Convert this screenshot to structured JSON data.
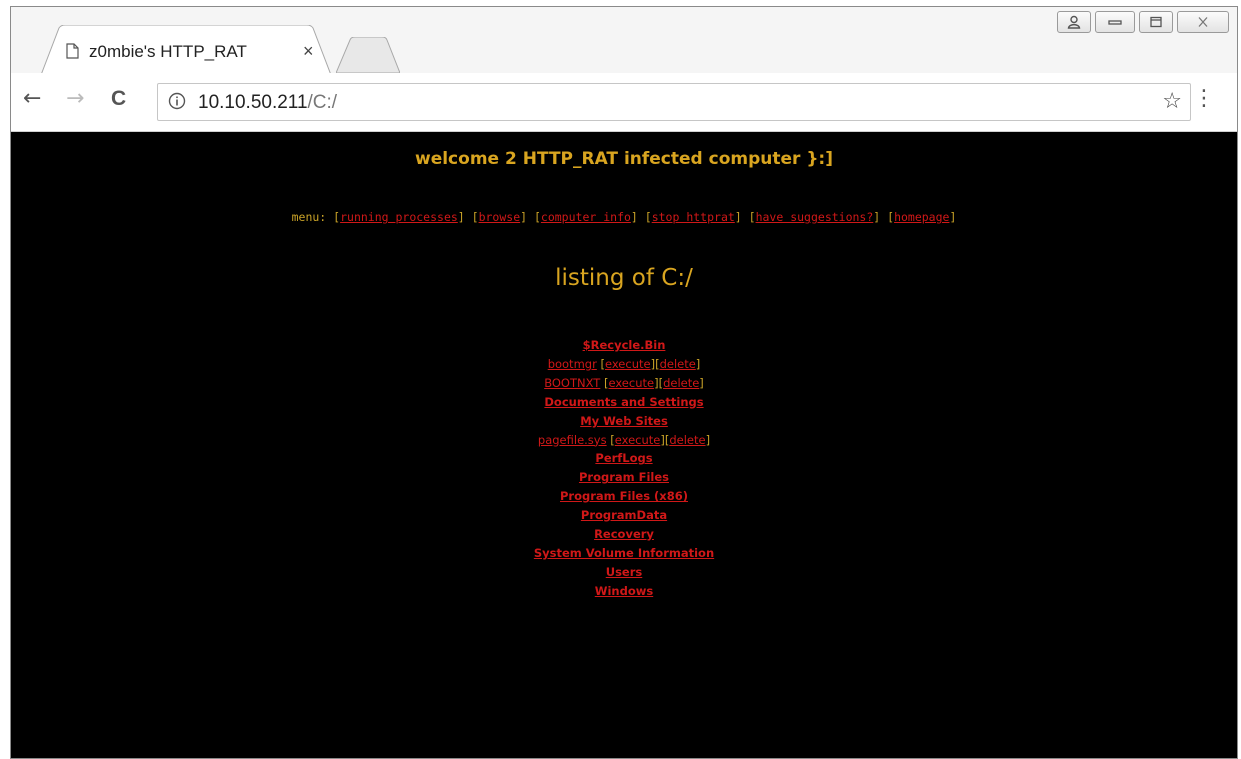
{
  "tab": {
    "title": "z0mbie's HTTP_RAT",
    "close": "×"
  },
  "toolbar": {
    "back": "←",
    "forward": "→",
    "reload": "C",
    "menu": "⋮"
  },
  "omnibox": {
    "host": "10.10.50.211",
    "path": "/C:/",
    "star": "☆"
  },
  "page": {
    "welcome": "welcome 2 HTTP_RAT infected computer }:]",
    "menu_label": "menu:",
    "menu_items": [
      "running processes",
      "browse",
      "computer info",
      "stop httprat",
      "have suggestions?",
      "homepage"
    ],
    "listing_title": "listing of C:/",
    "files": [
      {
        "name": "$Recycle.Bin",
        "type": "dir"
      },
      {
        "name": "bootmgr",
        "type": "file",
        "execute": "execute",
        "delete": "delete"
      },
      {
        "name": "BOOTNXT",
        "type": "file",
        "execute": "execute",
        "delete": "delete"
      },
      {
        "name": "Documents and Settings",
        "type": "dir"
      },
      {
        "name": "My Web Sites",
        "type": "dir"
      },
      {
        "name": "pagefile.sys",
        "type": "file",
        "execute": "execute",
        "delete": "delete"
      },
      {
        "name": "PerfLogs",
        "type": "dir"
      },
      {
        "name": "Program Files",
        "type": "dir"
      },
      {
        "name": "Program Files (x86)",
        "type": "dir"
      },
      {
        "name": "ProgramData",
        "type": "dir"
      },
      {
        "name": "Recovery",
        "type": "dir"
      },
      {
        "name": "System Volume Information",
        "type": "dir"
      },
      {
        "name": "Users",
        "type": "dir"
      },
      {
        "name": "Windows",
        "type": "dir"
      }
    ]
  },
  "colors": {
    "background": "#000000",
    "heading": "#d9a520",
    "link": "#d01818",
    "bracket": "#c9a227"
  }
}
